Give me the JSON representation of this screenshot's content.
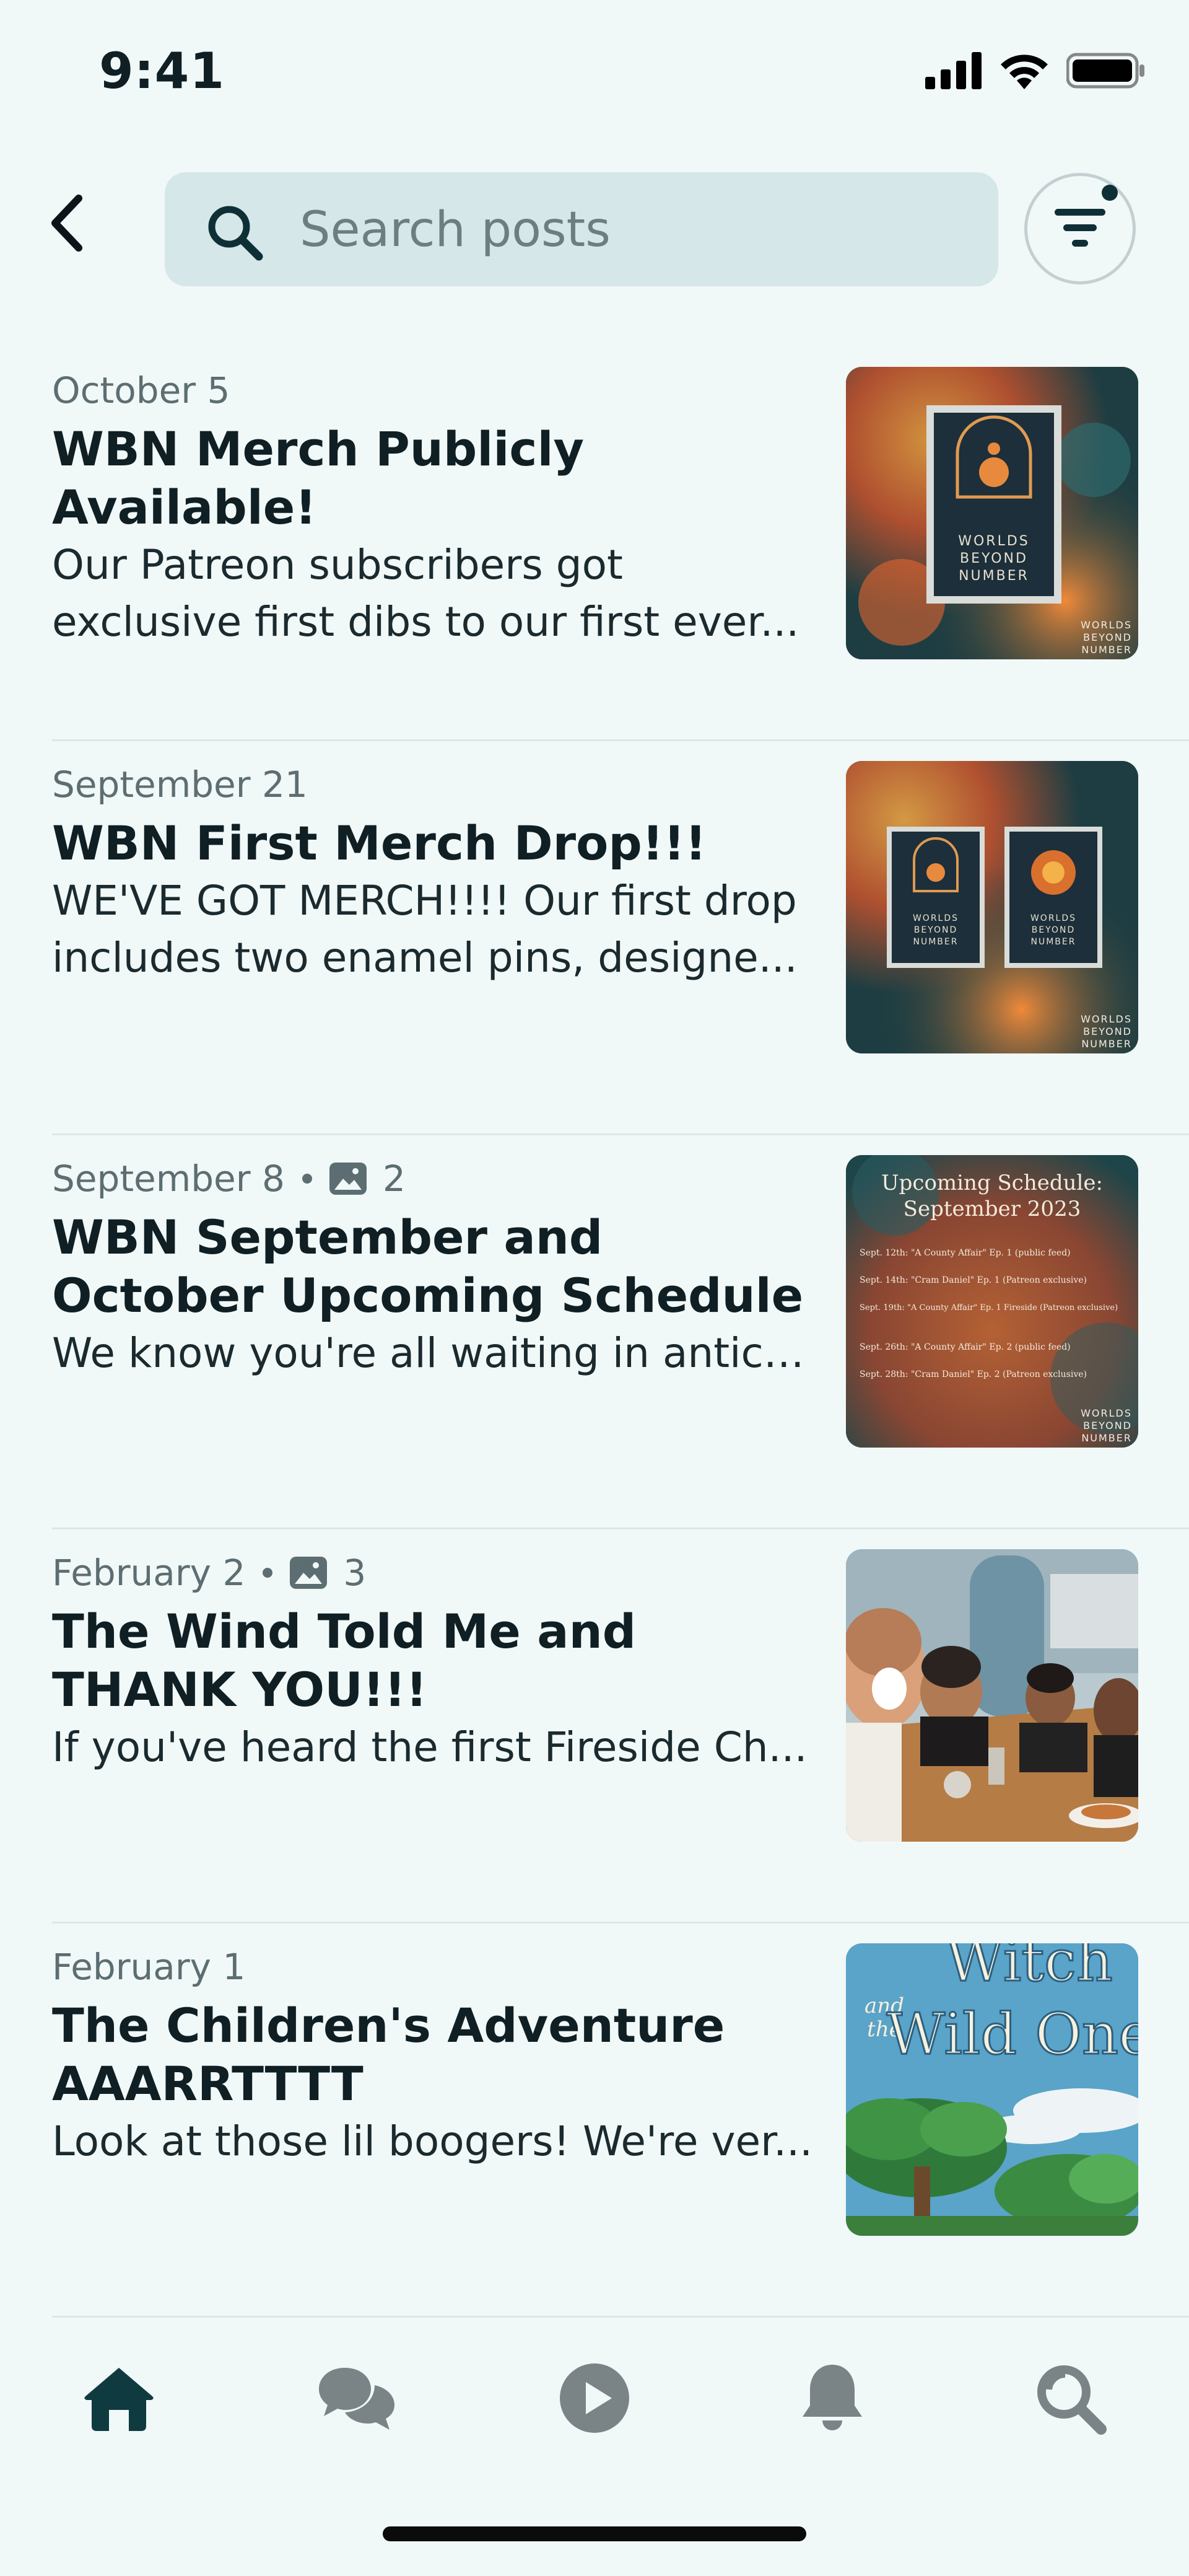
{
  "status_bar": {
    "time": "9:41"
  },
  "search": {
    "placeholder": "Search posts",
    "value": ""
  },
  "posts": [
    {
      "date": "October 5",
      "image_count": "",
      "title": "WBN Merch Publicly Available!",
      "snippet": "Our Patreon subscribers got exclusive first dibs to our first ever...",
      "thumb": {
        "kind": "poster",
        "poster_text": [
          "WORLDS",
          "BEYOND",
          "NUMBER"
        ],
        "corner_text": [
          "WORLDS",
          "BEYOND",
          "NUMBER"
        ]
      }
    },
    {
      "date": "September 21",
      "image_count": "",
      "title": "WBN First Merch Drop!!!",
      "snippet": "WE'VE GOT MERCH!!!! Our first drop includes two enamel pins, designe...",
      "thumb": {
        "kind": "two-pins",
        "pin_text": [
          "WORLDS",
          "BEYOND",
          "NUMBER"
        ],
        "corner_text": [
          "WORLDS",
          "BEYOND",
          "NUMBER"
        ]
      }
    },
    {
      "date": "September 8",
      "image_count": "2",
      "title": "WBN September and October Upcoming Schedule",
      "snippet": "We know you're all waiting in antici...",
      "thumb": {
        "kind": "schedule",
        "heading": [
          "Upcoming Schedule:",
          "September 2023"
        ],
        "lines": [
          "Sept. 12th: \"A County Affair\" Ep. 1 (public feed)",
          "Sept. 14th: \"Cram Daniel\" Ep. 1 (Patreon exclusive)",
          "Sept. 19th: \"A County Affair\" Ep. 1 Fireside (Patreon exclusive)",
          "Sept. 26th: \"A County Affair\" Ep. 2 (public feed)",
          "Sept. 28th: \"Cram Daniel\" Ep. 2 (Patreon exclusive)"
        ],
        "corner_text": [
          "WORLDS",
          "BEYOND",
          "NUMBER"
        ]
      }
    },
    {
      "date": "February 2",
      "image_count": "3",
      "title": "The Wind Told Me and THANK YOU!!!",
      "snippet": "If you've heard the first Fireside Ch...",
      "thumb": {
        "kind": "photo"
      }
    },
    {
      "date": "February 1",
      "image_count": "",
      "title": "The Children's Adventure AAARRTTTT",
      "snippet": "Look at those lil boogers! We're ver...",
      "thumb": {
        "kind": "book-cover",
        "title_words": [
          "and",
          "the",
          "Witch",
          "Wild One"
        ]
      }
    }
  ],
  "tab_bar": {
    "tabs": [
      {
        "icon": "home-icon",
        "active": true
      },
      {
        "icon": "chat-bubbles-icon",
        "active": false
      },
      {
        "icon": "play-icon",
        "active": false
      },
      {
        "icon": "bell-icon",
        "active": false
      },
      {
        "icon": "search-icon",
        "active": false
      }
    ],
    "active_color": "#0f3a40",
    "inactive_color": "#7a8486"
  },
  "colors": {
    "background": "#f1f8f8",
    "search_field": "#d5e7e8",
    "text_primary": "#0f1f24",
    "text_secondary": "#5d6e72"
  }
}
